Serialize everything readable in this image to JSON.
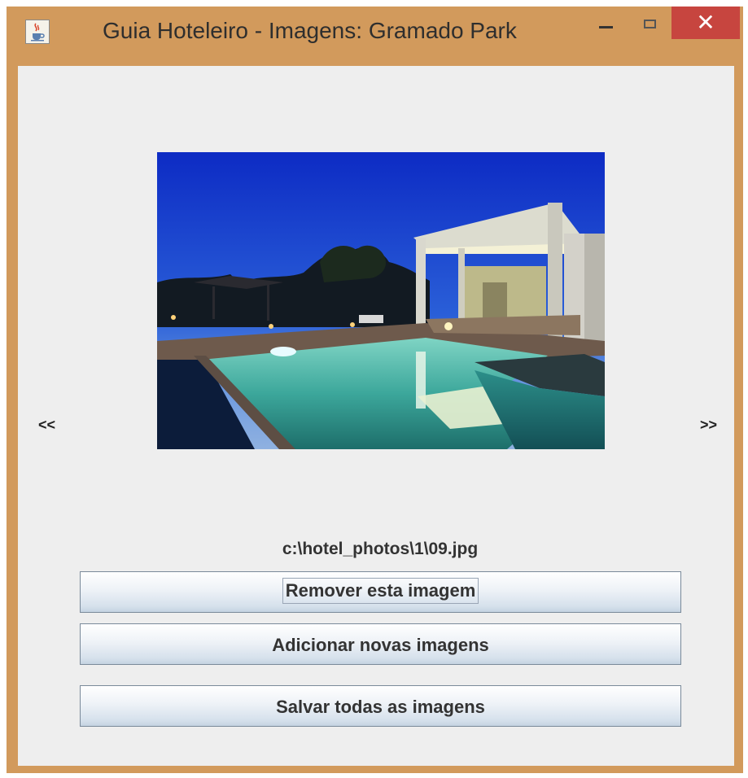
{
  "window": {
    "title": "Guia Hoteleiro - Imagens: Gramado Park",
    "icon": "java-cup-icon",
    "controls": {
      "minimize": "minimize-icon",
      "maximize": "maximize-icon",
      "close": "✕"
    },
    "frame_color": "#d29a5c",
    "close_color": "#c7453f"
  },
  "gallery": {
    "prev_label": "<<",
    "next_label": ">>",
    "image_path": "c:\\hotel_photos\\1\\09.jpg"
  },
  "actions": {
    "remove_label": "Remover esta imagem",
    "add_label": "Adicionar novas imagens",
    "save_label": "Salvar todas as imagens"
  }
}
